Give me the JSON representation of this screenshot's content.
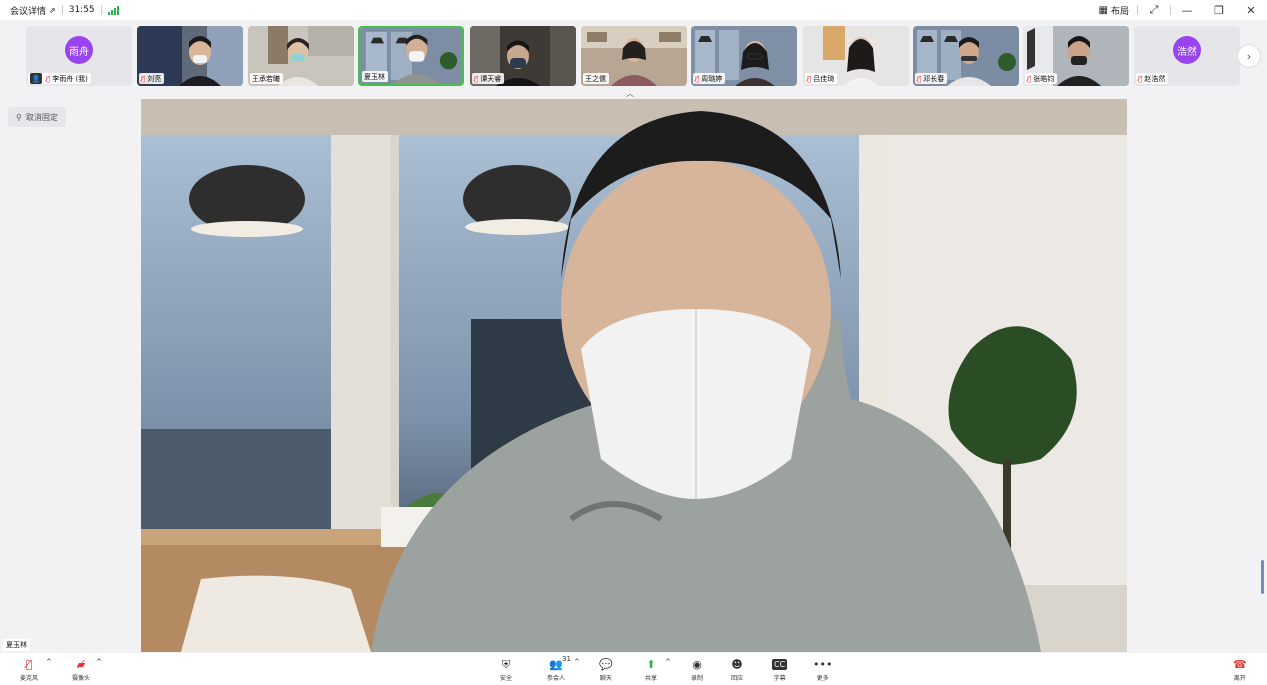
{
  "topbar": {
    "meeting_details": "会议详情",
    "timer": "31:55",
    "layout_label": "布局"
  },
  "participants": [
    {
      "name": "李雨舟 (我)",
      "avatar_text": "雨舟",
      "muted": true,
      "is_self": true,
      "video": false
    },
    {
      "name": "刘亮",
      "muted": true,
      "video": true
    },
    {
      "name": "王承若曦",
      "muted": false,
      "video": true
    },
    {
      "name": "夏玉林",
      "muted": false,
      "video": true,
      "active": true
    },
    {
      "name": "谭天睿",
      "muted": true,
      "video": true
    },
    {
      "name": "王之儒",
      "muted": false,
      "video": true
    },
    {
      "name": "周璐婷",
      "muted": true,
      "video": true
    },
    {
      "name": "吕佳琦",
      "muted": true,
      "video": true
    },
    {
      "name": "邓长春",
      "muted": true,
      "video": true
    },
    {
      "name": "张皓钧",
      "muted": true,
      "video": true
    },
    {
      "name": "赵浩然",
      "avatar_text": "浩然",
      "muted": true,
      "video": false
    }
  ],
  "unpin_label": "取消固定",
  "main_speaker": "夏玉林",
  "toolbar": {
    "mic": "麦克风",
    "camera": "摄像头",
    "security": "安全",
    "participants": "参会人",
    "participant_count": "31",
    "chat": "聊天",
    "share": "共享",
    "record": "录制",
    "reactions": "回应",
    "captions": "字幕",
    "more": "更多",
    "leave": "离开"
  },
  "colors": {
    "accent_green": "#45c04b",
    "danger_red": "#e5393a",
    "avatar_purple": "#9a43f0"
  }
}
